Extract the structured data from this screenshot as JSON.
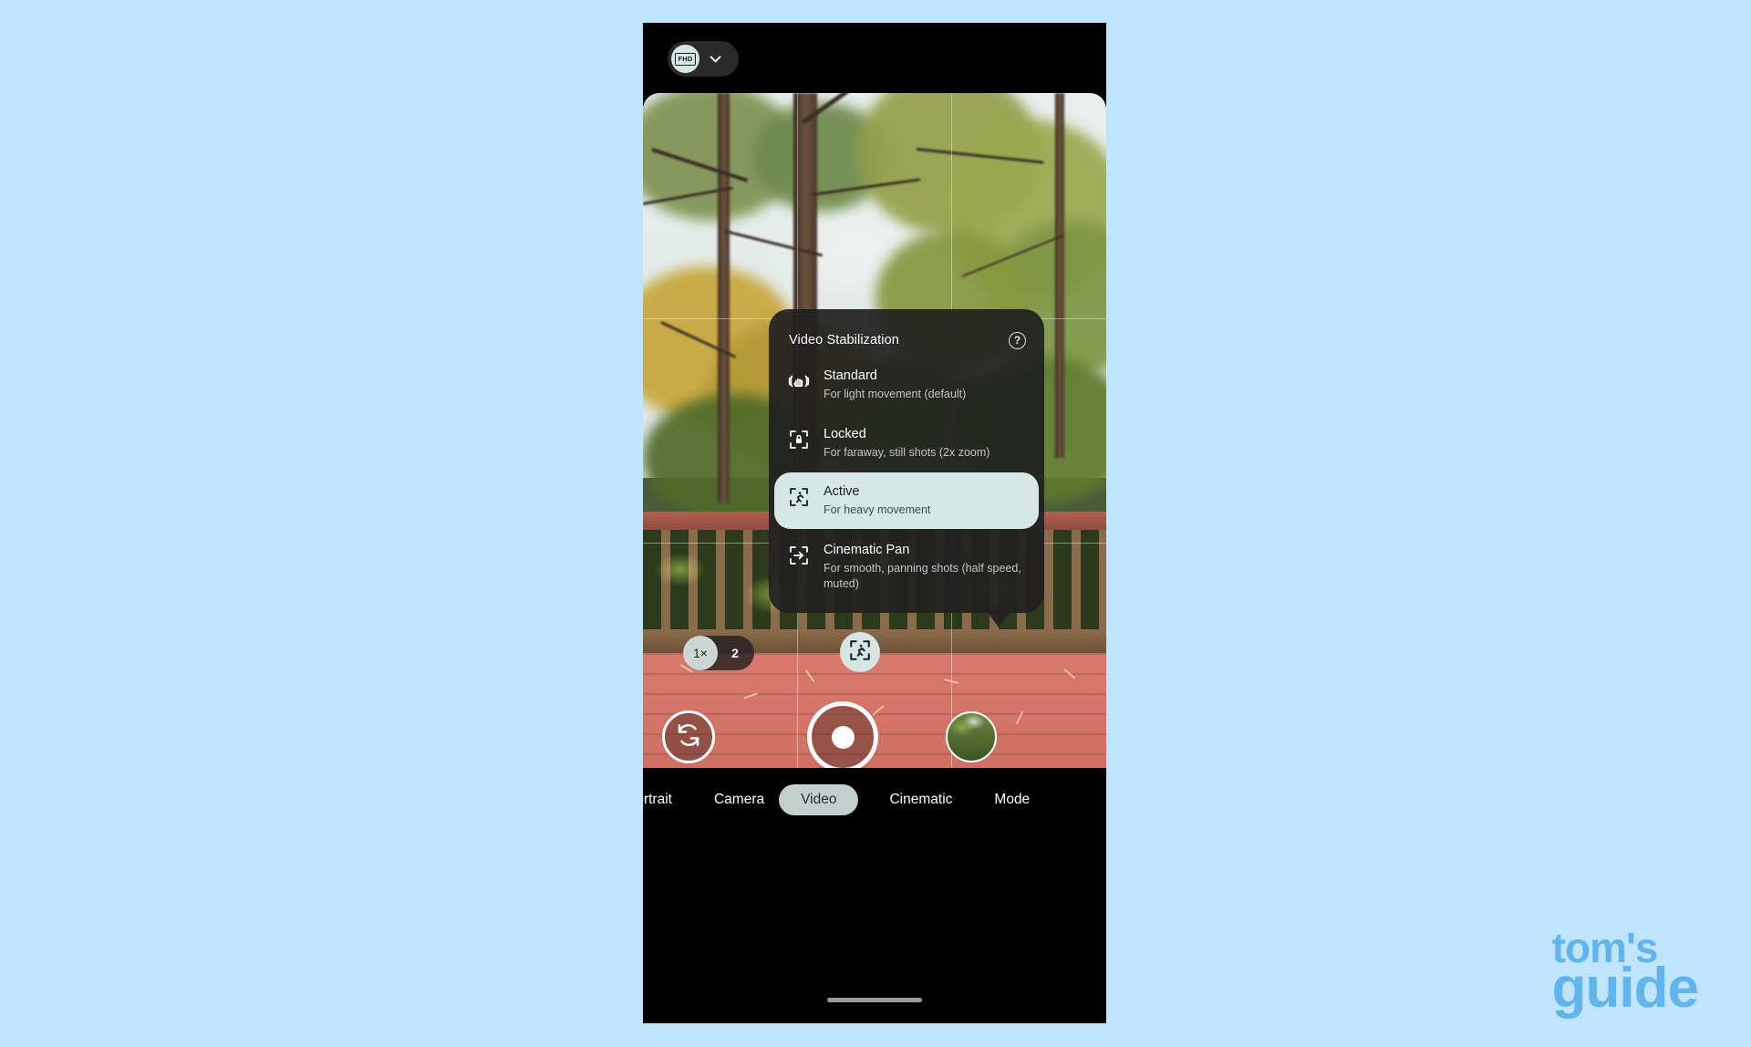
{
  "colors": {
    "page_background": "#bfe4fc",
    "dialog_background": "#202020",
    "selected_option": "#d6e8e5",
    "accent_chip": "#d6e6e3",
    "watermark": "#62b4ec"
  },
  "topbar": {
    "quality_badge_label": "FHD",
    "quality_chevron_icon": "chevron-down-icon"
  },
  "dialog": {
    "title": "Video Stabilization",
    "help_icon": "help-circle-icon",
    "help_label": "?",
    "options": [
      {
        "id": "standard",
        "icon": "hand-shake-stabilization-icon",
        "title": "Standard",
        "description": "For light movement (default)",
        "selected": false
      },
      {
        "id": "locked",
        "icon": "lock-frame-icon",
        "title": "Locked",
        "description": "For faraway, still shots (2x zoom)",
        "selected": false
      },
      {
        "id": "active",
        "icon": "running-person-frame-icon",
        "title": "Active",
        "description": "For heavy movement",
        "selected": true
      },
      {
        "id": "cinematic-pan",
        "icon": "arrow-pan-frame-icon",
        "title": "Cinematic Pan",
        "description": "For smooth, panning shots (half speed, muted)",
        "selected": false
      }
    ]
  },
  "viewfinder_controls": {
    "zoom": {
      "options": [
        {
          "label": "1×",
          "selected": true
        },
        {
          "label": "2",
          "selected": false
        }
      ]
    },
    "stabilization_button_icon": "running-person-frame-icon",
    "flip_camera_icon": "flip-camera-icon",
    "shutter_icon": "record-button-icon",
    "gallery_thumbnail_icon": "gallery-thumbnail"
  },
  "mode_bar": {
    "tabs": [
      {
        "label": "Portrait",
        "active": false
      },
      {
        "label": "Camera",
        "active": false
      },
      {
        "label": "Video",
        "active": true
      },
      {
        "label": "Cinematic",
        "active": false
      },
      {
        "label": "Mode",
        "active": false
      }
    ]
  },
  "watermark": {
    "line1": "tom's",
    "line2": "guide"
  }
}
